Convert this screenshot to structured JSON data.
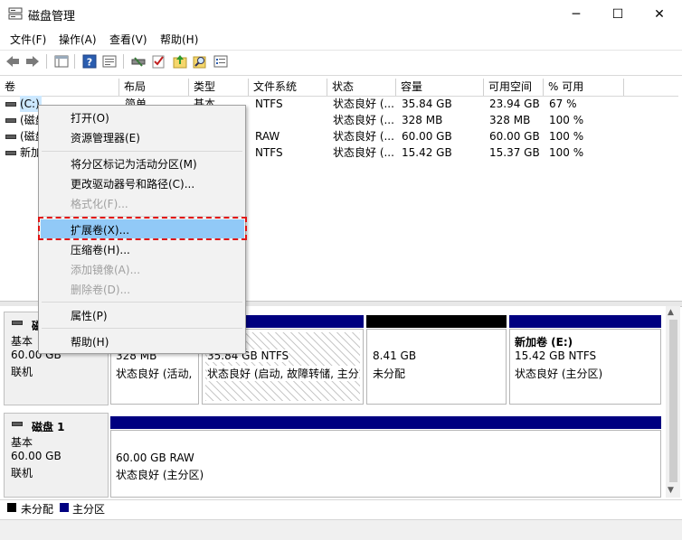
{
  "window": {
    "title": "磁盘管理",
    "minimize": "─",
    "maximize": "☐",
    "close": "✕"
  },
  "menu": [
    "文件(F)",
    "操作(A)",
    "查看(V)",
    "帮助(H)"
  ],
  "toolbar_icons": [
    "back-arrow-icon",
    "forward-arrow-icon",
    "table-view-icon",
    "help-icon",
    "properties-icon",
    "connect-icon",
    "check-icon",
    "up-folder-icon",
    "search-icon",
    "list-icon"
  ],
  "table": {
    "columns": [
      "卷",
      "布局",
      "类型",
      "文件系统",
      "状态",
      "容量",
      "可用空间",
      "% 可用"
    ],
    "rows": [
      {
        "vol": "(C:)",
        "layout": "简单",
        "type": "基本",
        "fs": "NTFS",
        "status": "状态良好 (...",
        "capacity": "35.84 GB",
        "free": "23.94 GB",
        "pct": "67 %"
      },
      {
        "vol": "(磁盘",
        "layout": "",
        "type": "",
        "fs": "",
        "status": "状态良好 (...",
        "capacity": "328 MB",
        "free": "328 MB",
        "pct": "100 %"
      },
      {
        "vol": "(磁盘",
        "layout": "",
        "type": "",
        "fs": "RAW",
        "status": "状态良好 (...",
        "capacity": "60.00 GB",
        "free": "60.00 GB",
        "pct": "100 %"
      },
      {
        "vol": "新加",
        "layout": "",
        "type": "",
        "fs": "NTFS",
        "status": "状态良好 (...",
        "capacity": "15.42 GB",
        "free": "15.37 GB",
        "pct": "100 %"
      }
    ]
  },
  "disk0": {
    "name": "磁",
    "kind": "基本",
    "size": "60.00 GB",
    "state": "联机",
    "partitions": [
      {
        "size": "328 MB",
        "status": "状态良好 (活动,"
      },
      {
        "size": "35.84 GB NTFS",
        "status": "状态良好 (启动, 故障转储, 主分"
      },
      {
        "size": "8.41 GB",
        "status": "未分配"
      },
      {
        "title": "新加卷 (E:)",
        "size": "15.42 GB NTFS",
        "status": "状态良好 (主分区)"
      }
    ]
  },
  "disk1": {
    "name": "磁盘 1",
    "kind": "基本",
    "size": "60.00 GB",
    "state": "联机",
    "partition": {
      "size": "60.00 GB RAW",
      "status": "状态良好 (主分区)"
    }
  },
  "legend": [
    {
      "label": "未分配",
      "color": "#000000"
    },
    {
      "label": "主分区",
      "color": "#000080"
    }
  ],
  "context_menu": {
    "items": [
      {
        "label": "打开(O)",
        "disabled": false
      },
      {
        "label": "资源管理器(E)",
        "disabled": false
      },
      {
        "label": "将分区标记为活动分区(M)",
        "disabled": false
      },
      {
        "label": "更改驱动器号和路径(C)...",
        "disabled": false
      },
      {
        "label": "格式化(F)...",
        "disabled": true
      },
      {
        "label": "扩展卷(X)...",
        "disabled": false,
        "highlighted": true
      },
      {
        "label": "压缩卷(H)...",
        "disabled": false
      },
      {
        "label": "添加镜像(A)...",
        "disabled": true
      },
      {
        "label": "删除卷(D)...",
        "disabled": true
      },
      {
        "label": "属性(P)",
        "disabled": false
      },
      {
        "label": "帮助(H)",
        "disabled": false
      }
    ]
  },
  "colors": {
    "primary_partition": "#000080",
    "unallocated": "#000000",
    "highlight": "#91c9f7",
    "callout": "#e01515"
  }
}
